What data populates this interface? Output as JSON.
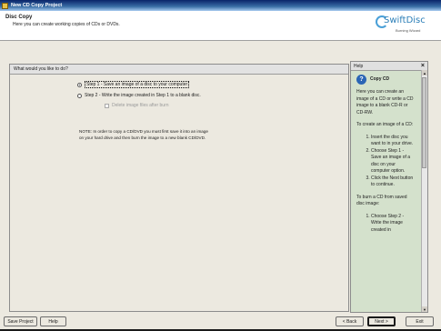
{
  "window": {
    "title": "New CD Copy Project",
    "minimize": "_",
    "maximize": "□",
    "close": "✕"
  },
  "header": {
    "title": "Disc Copy",
    "description": "Here you can create working copies of CDs or DVDs.",
    "logo_name": "SwiftDisc",
    "logo_sub": "Burning Wizard"
  },
  "main": {
    "question": "What would you like to do?",
    "step1": "Step 1 - Save an image of a disc to your computer",
    "step2": "Step 2 - Write the image created in Step 1 to a blank disc.",
    "delete_option": "Delete image files after burn",
    "note_line1": "NOTE: In order to copy a CD/DVD you must first save it into an image",
    "note_line2": "on your hard drive and then burn the image to a new blank CD/DVD."
  },
  "help": {
    "panel_title": "Help",
    "close": "×",
    "icon": "?",
    "heading": "Copy CD",
    "intro": "Here you can create an image of a CD or write a CD image to a blank CD-R or CD-RW.",
    "create_heading": "To create an image of a CD:",
    "create_steps": [
      "Insert the disc you want to in your drive.",
      "Choose Step 1 - Save an image of a disc on your computer option.",
      "Click the Next button to continue."
    ],
    "burn_heading": "To burn a CD from saved disc image:",
    "burn_steps": [
      "Choose Step 2 - Write the image created in"
    ]
  },
  "footer": {
    "save_project": "Save Project",
    "help": "Help",
    "back": "< Back",
    "next": "Next >",
    "exit": "Exit"
  }
}
